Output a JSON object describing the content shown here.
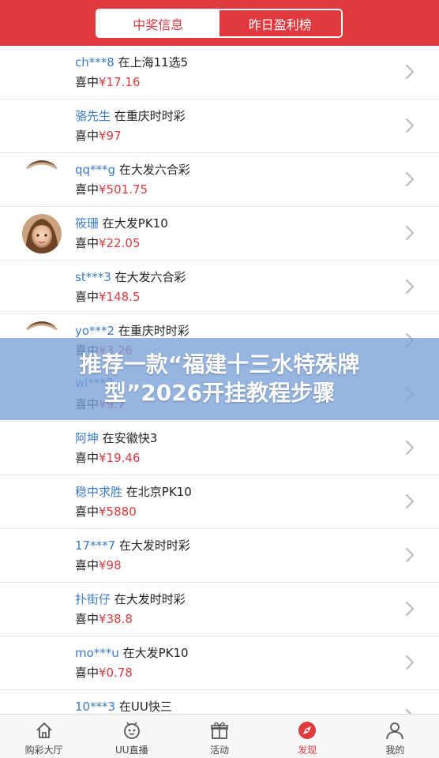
{
  "header": {
    "tabs": [
      {
        "label": "中奖信息",
        "active": true
      },
      {
        "label": "昨日盈利榜",
        "active": false
      }
    ]
  },
  "won_label": "喜中",
  "currency": "¥",
  "list": [
    {
      "user": "ch***8",
      "place": "在上海11选5",
      "amount": "17.16",
      "avatar": "none"
    },
    {
      "user": "骆先生",
      "place": "在重庆时时彩",
      "amount": "97",
      "avatar": "none"
    },
    {
      "user": "qq***g",
      "place": "在大发六合彩",
      "amount": "501.75",
      "avatar": "partial"
    },
    {
      "user": "筱珊",
      "place": "在大发PK10",
      "amount": "22.05",
      "avatar": "photo"
    },
    {
      "user": "st***3",
      "place": "在大发六合彩",
      "amount": "148.5",
      "avatar": "none"
    },
    {
      "user": "yo***2",
      "place": "在重庆时时彩",
      "amount": "3.26",
      "avatar": "partial"
    },
    {
      "user": "wl***8",
      "place": "",
      "amount": "9.7",
      "avatar": "none"
    },
    {
      "user": "阿坤",
      "place": "在安徽快3",
      "amount": "19.46",
      "avatar": "none"
    },
    {
      "user": "稳中求胜",
      "place": "在北京PK10",
      "amount": "5880",
      "avatar": "none"
    },
    {
      "user": "17***7",
      "place": "在大发时时彩",
      "amount": "98",
      "avatar": "none"
    },
    {
      "user": "扑街仔",
      "place": "在大发时时彩",
      "amount": "38.8",
      "avatar": "none"
    },
    {
      "user": "mo***u",
      "place": "在大发PK10",
      "amount": "0.78",
      "avatar": "none"
    },
    {
      "user": "10***3",
      "place": "在UU快三",
      "amount": "",
      "avatar": "none"
    }
  ],
  "banner": {
    "text": "推荐一款“福建十三水特殊牌型”2026开挂教程步骤"
  },
  "nav": [
    {
      "label": "购彩大厅",
      "icon": "home-icon",
      "active": false
    },
    {
      "label": "UU直播",
      "icon": "live-tv-icon",
      "active": false
    },
    {
      "label": "活动",
      "icon": "gift-icon",
      "active": false
    },
    {
      "label": "发现",
      "icon": "compass-icon",
      "active": true
    },
    {
      "label": "我的",
      "icon": "user-icon",
      "active": false
    }
  ],
  "colors": {
    "brand_red": "#e03a3e",
    "username_blue": "#3d7cc9",
    "banner_overlay": "#78a0d7"
  }
}
